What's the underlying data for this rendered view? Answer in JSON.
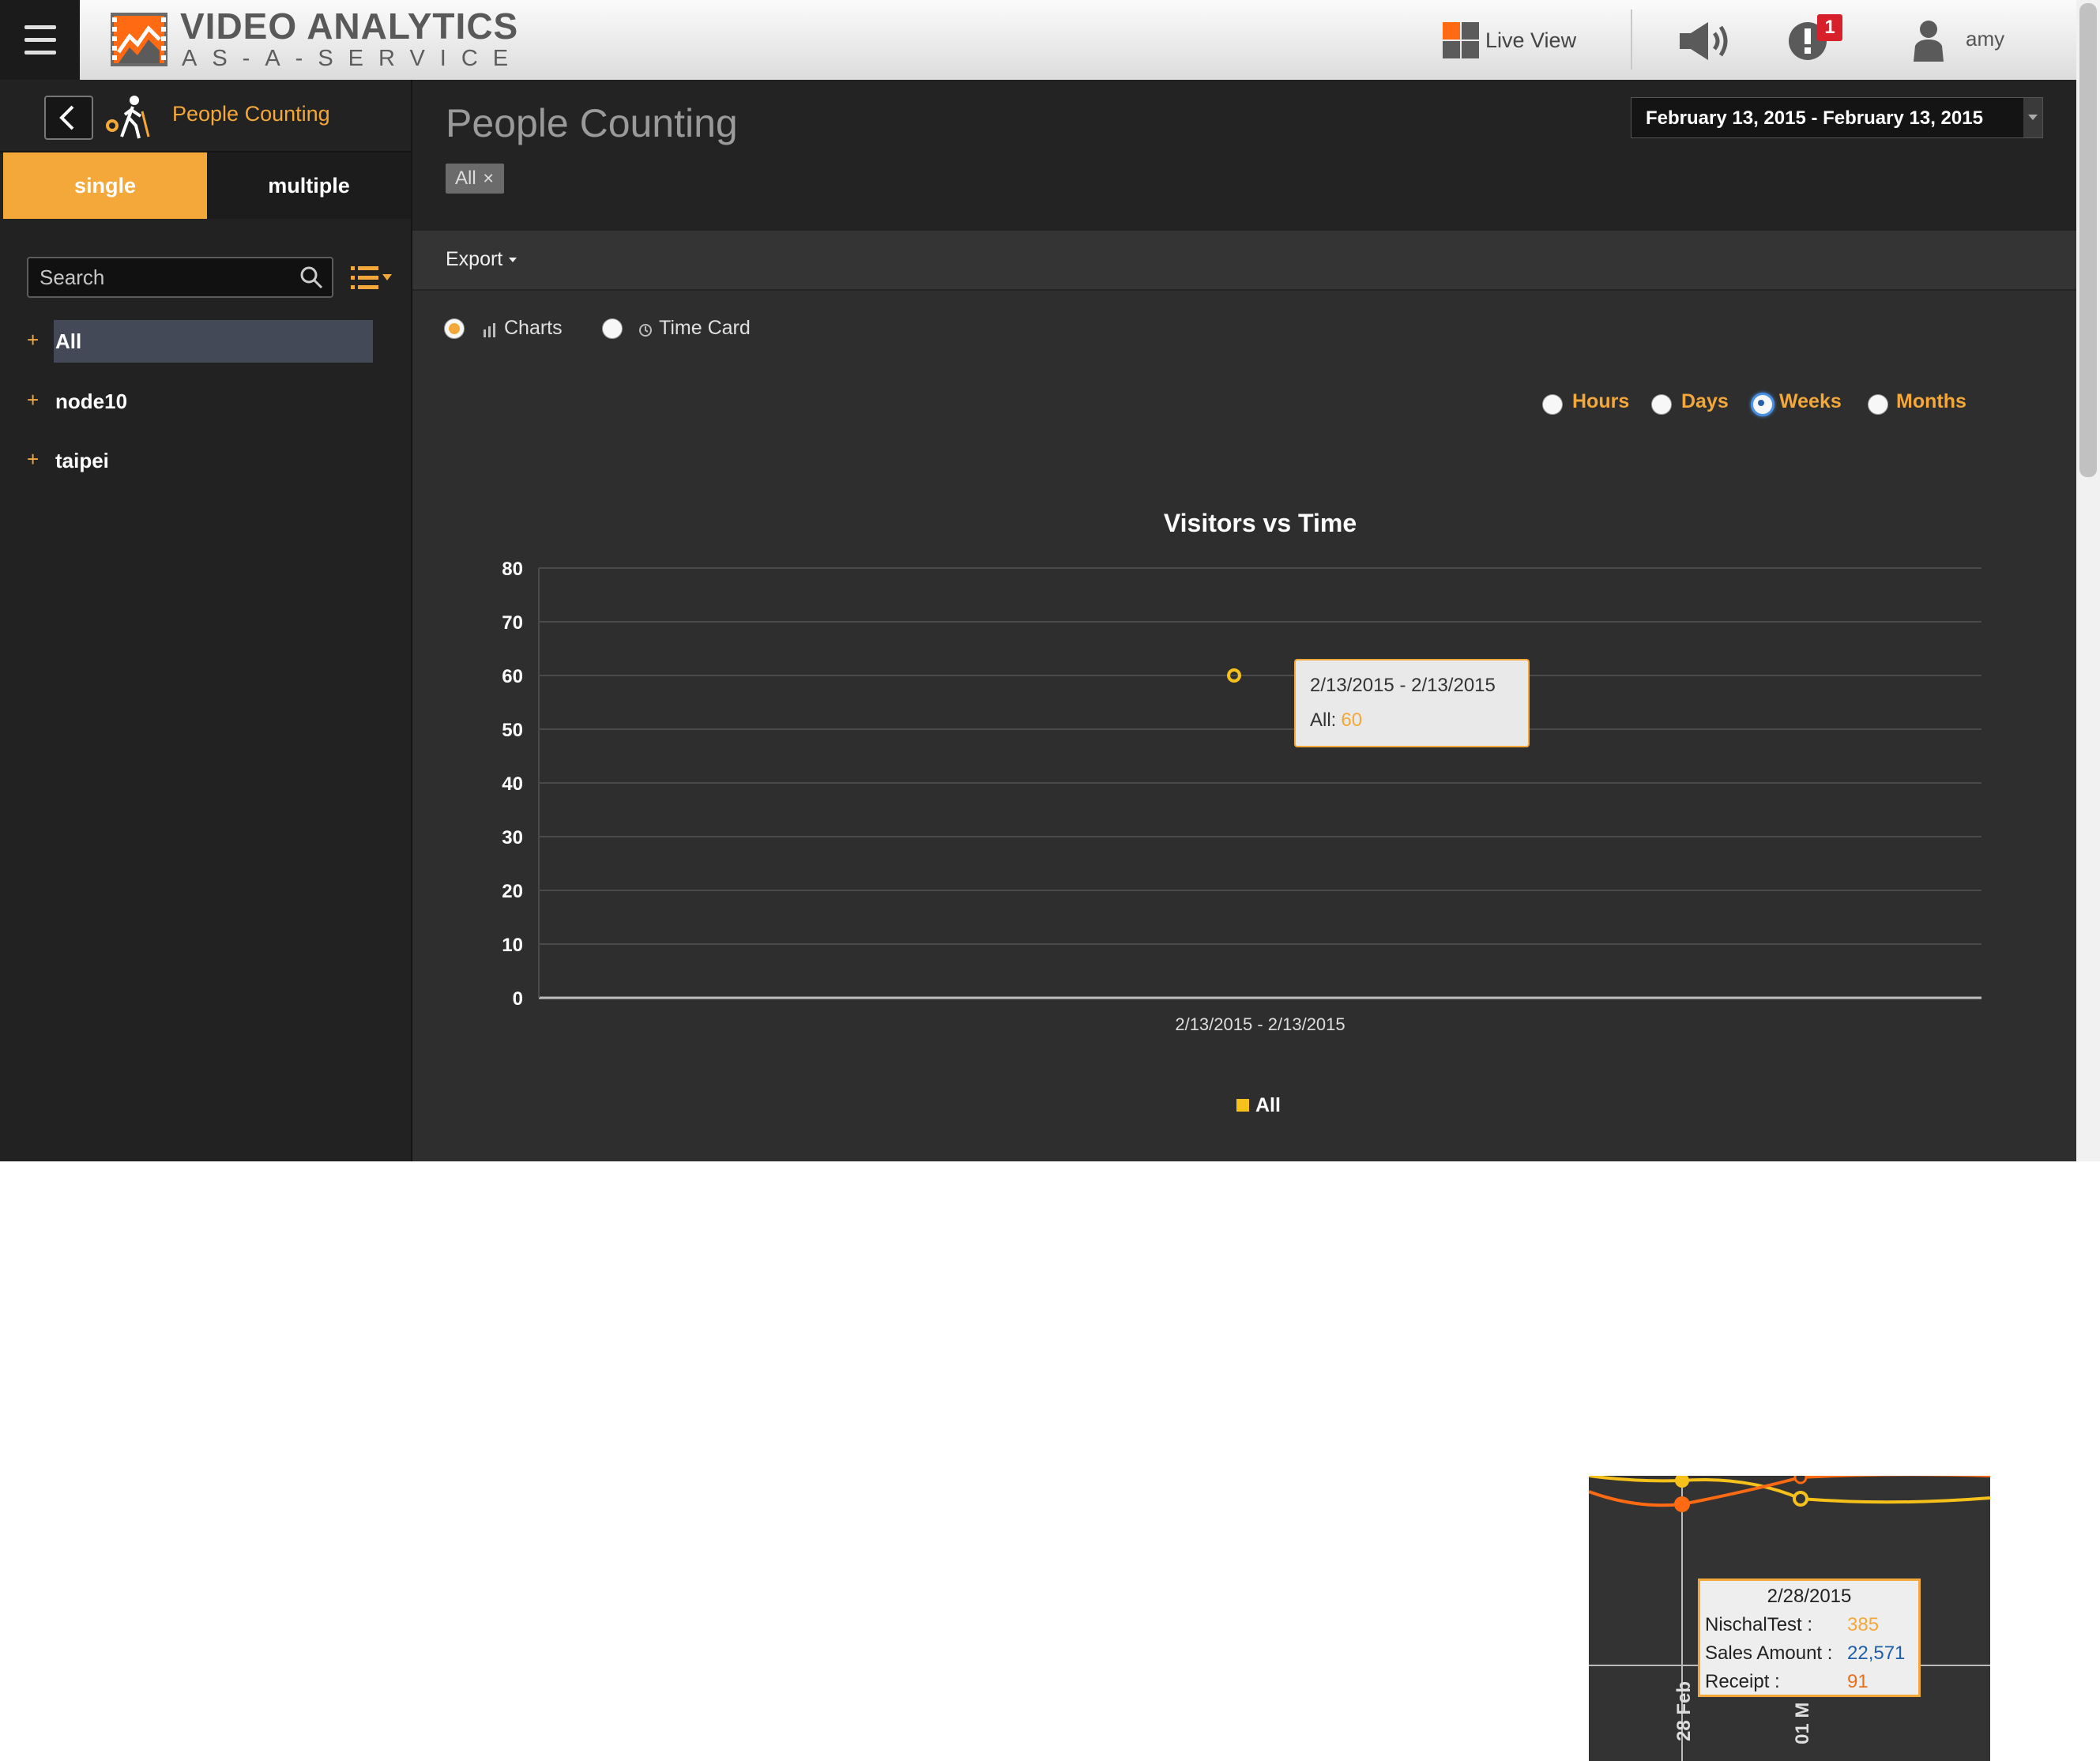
{
  "app": {
    "title": "VIDEO ANALYTICS",
    "subtitle": "AS-A-SERVICE",
    "live_view_label": "Live View",
    "alert_count": "1",
    "user_name": "amy",
    "live_view_colors": [
      "#ff6a13",
      "#5b5b5b",
      "#5b5b5b",
      "#5b5b5b"
    ]
  },
  "sidebar": {
    "title": "People Counting",
    "tabs": {
      "single": "single",
      "multiple": "multiple",
      "active": "single"
    },
    "search": {
      "placeholder": "Search",
      "value": ""
    },
    "items": [
      {
        "label": "All",
        "active": true
      },
      {
        "label": "node10",
        "active": false
      },
      {
        "label": "taipei",
        "active": false
      }
    ]
  },
  "main": {
    "title": "People Counting",
    "filter_chip": "All",
    "date_range": "February 13, 2015 - February 13, 2015",
    "export_label": "Export",
    "view_options": [
      {
        "label": "Charts",
        "icon": "bar-chart-icon",
        "checked": true
      },
      {
        "label": "Time Card",
        "icon": "clock-icon",
        "checked": false
      }
    ],
    "period_options": [
      {
        "label": "Hours",
        "checked": false
      },
      {
        "label": "Days",
        "checked": false
      },
      {
        "label": "Weeks",
        "checked": true
      },
      {
        "label": "Months",
        "checked": false
      }
    ],
    "tooltip": {
      "header": "2/13/2015 - 2/13/2015",
      "series": "All:",
      "value": "60"
    }
  },
  "chart_data": {
    "type": "line",
    "title": "Visitors vs Time",
    "xlabel": "",
    "ylabel": "",
    "categories": [
      "2/13/2015 - 2/13/2015"
    ],
    "series": [
      {
        "name": "All",
        "values": [
          60
        ],
        "color": "#f7c11b"
      }
    ],
    "ylim": [
      0,
      80
    ],
    "yticks": [
      0,
      10,
      20,
      30,
      40,
      50,
      60,
      70,
      80
    ],
    "grid": true,
    "legend": "bottom"
  },
  "inset": {
    "date": "2/28/2015",
    "rows": [
      {
        "label": "NischalTest :",
        "value": "385",
        "color": "#f4a83a"
      },
      {
        "label": "Sales Amount :",
        "value": "22,571",
        "color": "#1f5fa8"
      },
      {
        "label": "Receipt :",
        "value": "91",
        "color": "#e8701a"
      }
    ],
    "axis_labels": [
      "28 Feb",
      "01 M"
    ],
    "series_colors": [
      "#f7c11b",
      "#ff6a13"
    ]
  }
}
